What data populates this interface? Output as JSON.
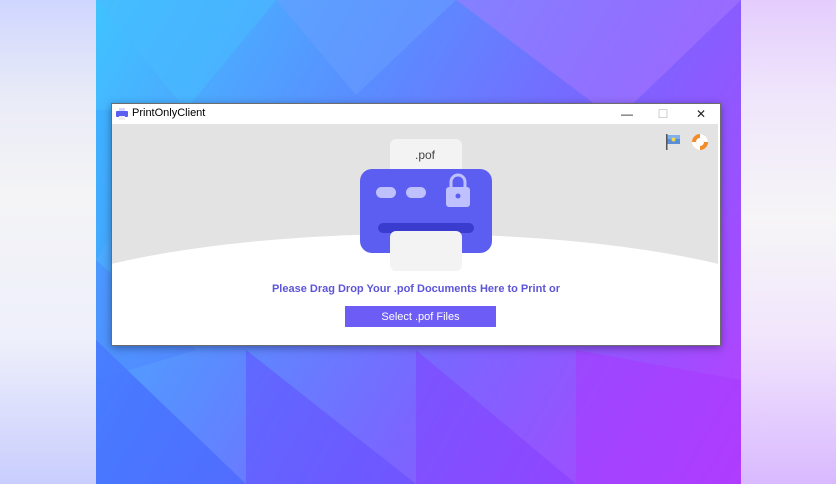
{
  "window": {
    "title": "PrintOnlyClient",
    "minimize_glyph": "—",
    "maximize_glyph": "☐",
    "close_glyph": "✕"
  },
  "toolbar": {
    "language_icon": "flag-icon",
    "help_icon": "lifebuoy-icon"
  },
  "hero": {
    "paper_label": ".pof",
    "illustration": "printer-lock-icon"
  },
  "main": {
    "message": "Please Drag  Drop Your .pof Documents Here to Print or",
    "select_button_label": "Select .pof Files"
  },
  "colors": {
    "accent": "#6d5cf5",
    "message_text": "#5d55d8",
    "printer_body": "#5b5ef0",
    "background_gradient_start": "#3fc4ff",
    "background_gradient_end": "#b83fff"
  }
}
